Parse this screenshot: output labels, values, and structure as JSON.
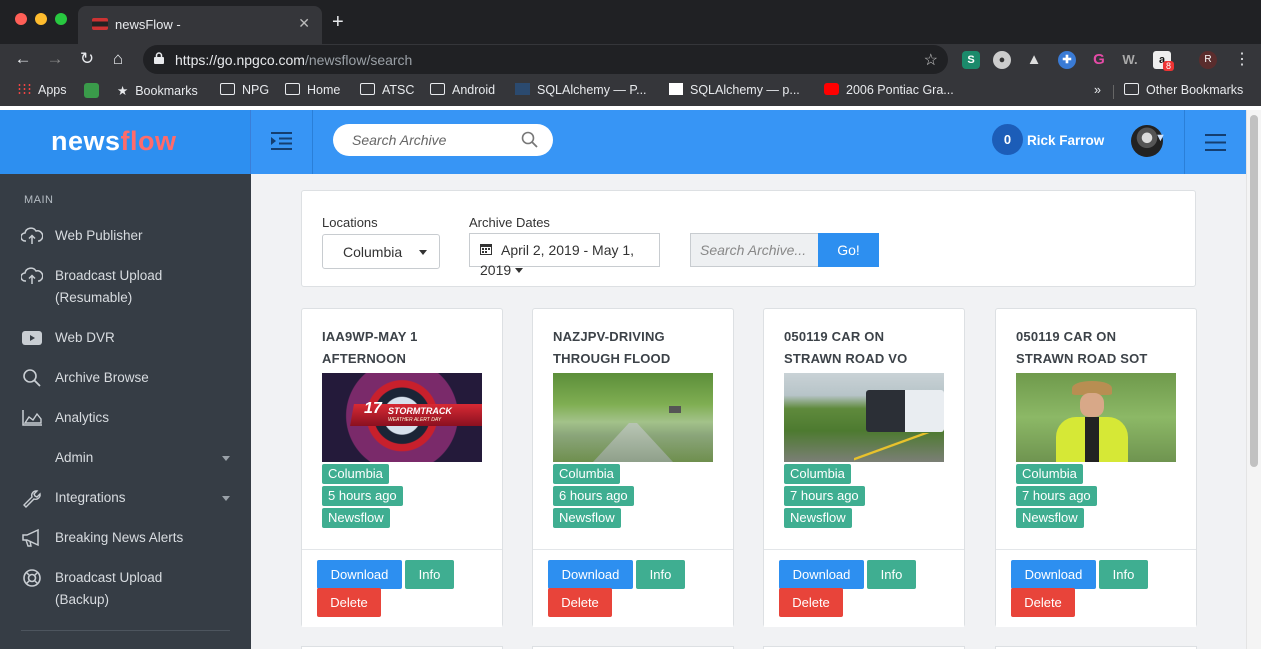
{
  "browser": {
    "tab_title": "newsFlow -",
    "url_domain": "https://go.npgco.com",
    "url_path": "/newsflow/search",
    "extension_badge": "8",
    "profile_initial": "R",
    "bookmarks": [
      "Apps",
      "Bookmarks",
      "NPG",
      "Home",
      "ATSC",
      "Android",
      "SQLAlchemy — P...",
      "SQLAlchemy — p...",
      "2006 Pontiac Gra..."
    ],
    "bookmarks_overflow": "»",
    "other_bookmarks": "Other Bookmarks"
  },
  "brand": {
    "part1": "news",
    "part2": "flow"
  },
  "header": {
    "search_placeholder": "Search Archive",
    "notification_count": "0",
    "user_name": "Rick Farrow"
  },
  "sidebar": {
    "heading": "MAIN",
    "items": [
      {
        "label": "Web Publisher",
        "icon": "cloud-upload-icon"
      },
      {
        "label": "Broadcast Upload",
        "label2": "(Resumable)",
        "icon": "cloud-upload-icon"
      },
      {
        "label": "Web DVR",
        "icon": "youtube-icon"
      },
      {
        "label": "Archive Browse",
        "icon": "search-icon"
      },
      {
        "label": "Analytics",
        "icon": "area-chart-icon"
      },
      {
        "label": "Admin",
        "icon": "none"
      },
      {
        "label": "Integrations",
        "icon": "wrench-icon"
      },
      {
        "label": "Breaking News Alerts",
        "icon": "megaphone-icon"
      },
      {
        "label": "Broadcast Upload",
        "label2": "(Backup)",
        "icon": "lifebuoy-icon"
      }
    ]
  },
  "filters": {
    "locations_label": "Locations",
    "location_value": "Columbia",
    "dates_label": "Archive Dates",
    "date_line1": "April 2, 2019 - May 1,",
    "date_line2": "2019",
    "search_placeholder": "Search Archive...",
    "go_label": "Go!"
  },
  "cards": [
    {
      "title1": "IAA9WP-MAY 1",
      "title2": "AFTERNOON",
      "location": "Columbia",
      "age": "5 hours ago",
      "source": "Newsflow",
      "thumb_text": "STORMTRACK",
      "thumb_sub": "WEATHER ALERT DAY",
      "thumb_num": "17"
    },
    {
      "title1": "NAZJPV-DRIVING",
      "title2": "THROUGH FLOOD",
      "location": "Columbia",
      "age": "6 hours ago",
      "source": "Newsflow"
    },
    {
      "title1": "050119 CAR ON",
      "title2": "STRAWN ROAD VO",
      "location": "Columbia",
      "age": "7 hours ago",
      "source": "Newsflow"
    },
    {
      "title1": "050119 CAR ON",
      "title2": "STRAWN ROAD SOT",
      "location": "Columbia",
      "age": "7 hours ago",
      "source": "Newsflow"
    }
  ],
  "card_actions": {
    "download": "Download",
    "info": "Info",
    "delete": "Delete"
  },
  "colors": {
    "primary": "#2d8ff0",
    "success": "#3fae91",
    "danger": "#e8443a",
    "sidebar": "#363d45"
  }
}
